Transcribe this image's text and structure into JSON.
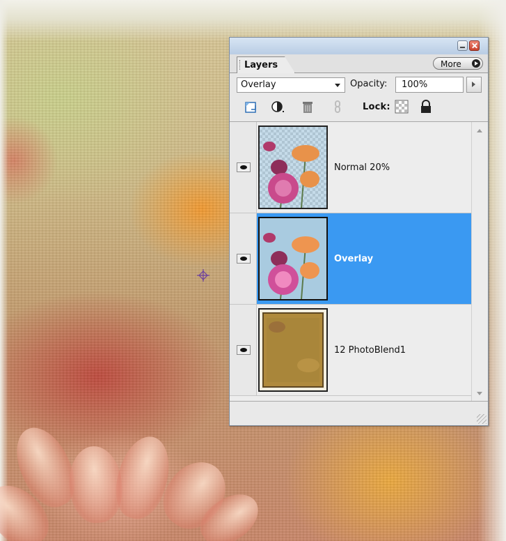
{
  "palette": {
    "tab_label": "Layers",
    "more_label": "More",
    "blend_mode": "Overlay",
    "opacity_label": "Opacity:",
    "opacity_value": "100%",
    "lock_label": "Lock:",
    "layers": [
      {
        "name": "Normal 20%",
        "visible": true,
        "selected": false
      },
      {
        "name": "Overlay",
        "visible": true,
        "selected": true
      },
      {
        "name": "12 PhotoBlend1",
        "visible": true,
        "selected": false
      }
    ]
  },
  "colors": {
    "selection": "#3a99f2",
    "panel_bg": "#e9e9e9",
    "titlebar": "#c6d7eb"
  },
  "icons": [
    "new-layer-icon",
    "adjustment-layer-icon",
    "trash-icon",
    "link-icon",
    "lock-transparency-icon",
    "lock-all-icon",
    "eye-icon",
    "minimize-icon",
    "close-icon",
    "crosshair-cursor-icon"
  ]
}
